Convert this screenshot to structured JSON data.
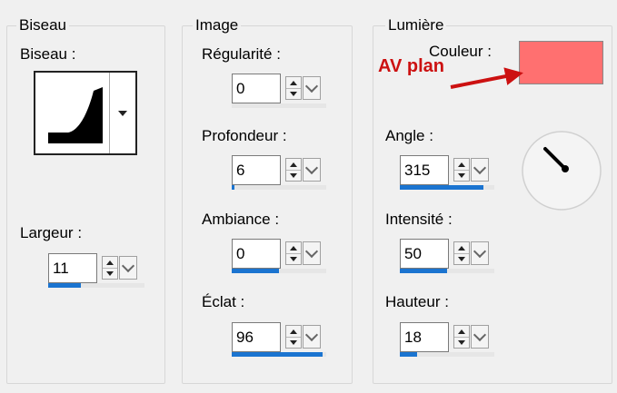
{
  "biseau": {
    "group_title": "Biseau",
    "label": "Biseau :",
    "largeur_label": "Largeur :",
    "largeur_value": "11",
    "largeur_level": 0.34
  },
  "image": {
    "group_title": "Image",
    "regularite_label": "Régularité :",
    "regularite_value": "0",
    "regularite_level": 0.0,
    "profondeur_label": "Profondeur :",
    "profondeur_value": "6",
    "profondeur_level": 0.03,
    "ambiance_label": "Ambiance :",
    "ambiance_value": "0",
    "ambiance_level": 0.5,
    "eclat_label": "Éclat :",
    "eclat_value": "96",
    "eclat_level": 0.96
  },
  "lumiere": {
    "group_title": "Lumière",
    "couleur_label": "Couleur :",
    "couleur_color": "#ff7070",
    "annotation": "AV plan",
    "angle_label": "Angle :",
    "angle_value": "315",
    "angle_level": 0.88,
    "intensite_label": "Intensité :",
    "intensite_value": "50",
    "intensite_level": 0.5,
    "hauteur_label": "Hauteur :",
    "hauteur_value": "18",
    "hauteur_level": 0.18
  },
  "colors": {
    "progress_fill": "#1b74d0",
    "annotation": "#cc1111"
  }
}
